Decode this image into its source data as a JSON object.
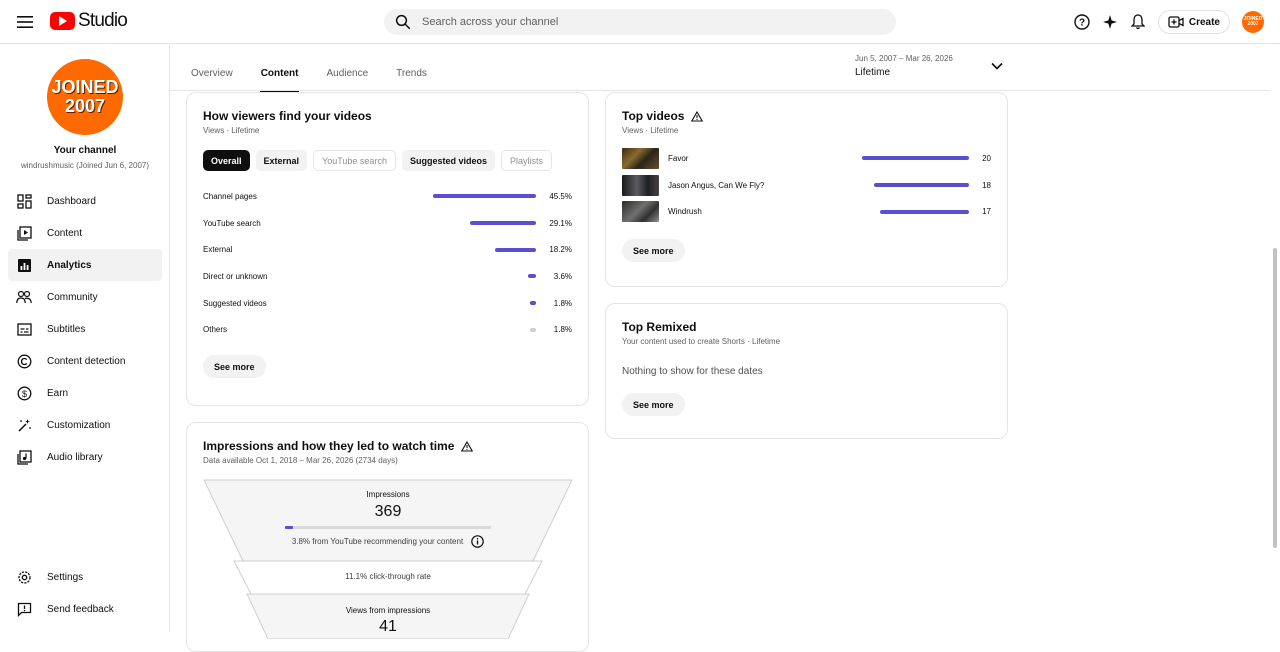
{
  "app": {
    "name": "Studio"
  },
  "search": {
    "placeholder": "Search across your channel"
  },
  "header": {
    "create_label": "Create",
    "avatar_text_1": "JOINED",
    "avatar_text_2": "2007"
  },
  "channel": {
    "avatar_line1": "JOINED",
    "avatar_line2": "2007",
    "title": "Your channel",
    "subtitle": "windrushmusic (Joined Jun 6, 2007)"
  },
  "sidebar": {
    "items": [
      {
        "label": "Dashboard",
        "icon": "dashboard-icon"
      },
      {
        "label": "Content",
        "icon": "content-icon"
      },
      {
        "label": "Analytics",
        "icon": "analytics-icon"
      },
      {
        "label": "Community",
        "icon": "community-icon"
      },
      {
        "label": "Subtitles",
        "icon": "subtitles-icon"
      },
      {
        "label": "Content detection",
        "icon": "copyright-icon"
      },
      {
        "label": "Earn",
        "icon": "dollar-icon"
      },
      {
        "label": "Customization",
        "icon": "wand-icon"
      },
      {
        "label": "Audio library",
        "icon": "audio-library-icon"
      }
    ],
    "bottom": [
      {
        "label": "Settings",
        "icon": "gear-icon"
      },
      {
        "label": "Send feedback",
        "icon": "feedback-icon"
      }
    ]
  },
  "tabs": [
    "Overview",
    "Content",
    "Audience",
    "Trends"
  ],
  "date_range": {
    "range": "Jun 5, 2007 – Mar 26, 2026",
    "label": "Lifetime"
  },
  "traffic": {
    "title": "How viewers find your videos",
    "subtitle": "Views · Lifetime",
    "chips": [
      "Overall",
      "External",
      "YouTube search",
      "Suggested videos",
      "Playlists"
    ],
    "rows": [
      {
        "label": "Channel pages",
        "pct": "45.5%",
        "value": 45.5
      },
      {
        "label": "YouTube search",
        "pct": "29.1%",
        "value": 29.1
      },
      {
        "label": "External",
        "pct": "18.2%",
        "value": 18.2
      },
      {
        "label": "Direct or unknown",
        "pct": "3.6%",
        "value": 3.6
      },
      {
        "label": "Suggested videos",
        "pct": "1.8%",
        "value": 1.8
      },
      {
        "label": "Others",
        "pct": "1.8%",
        "value": 1.8
      }
    ],
    "see_more": "See more"
  },
  "impressions": {
    "title": "Impressions and how they led to watch time",
    "subtitle": "Data available Oct 1, 2018 – Mar 26, 2026 (2734 days)",
    "impressions_label": "Impressions",
    "impressions_value": "369",
    "recommend_text": "3.8% from YouTube recommending your content",
    "recommend_fraction": 0.038,
    "ctr_text": "11.1% click-through rate",
    "views_label": "Views from impressions",
    "views_value": "41"
  },
  "top_videos": {
    "title": "Top videos",
    "subtitle": "Views · Lifetime",
    "rows": [
      {
        "title": "Favor",
        "views": "20",
        "value": 20
      },
      {
        "title": "Jason Angus, Can We Fly?",
        "views": "18",
        "value": 18
      },
      {
        "title": "Windrush",
        "views": "17",
        "value": 17
      }
    ],
    "see_more": "See more"
  },
  "top_remixed": {
    "title": "Top Remixed",
    "subtitle": "Your content used to create Shorts · Lifetime",
    "empty": "Nothing to show for these dates",
    "see_more": "See more"
  }
}
